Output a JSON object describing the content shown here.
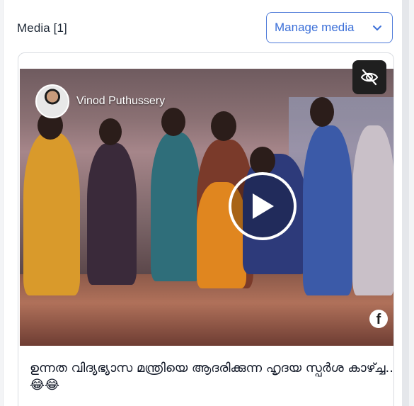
{
  "header": {
    "title": "Media [1]",
    "manage_label": "Manage media"
  },
  "media": {
    "channel_name": "Vinod Puthussery",
    "caption": "ഉന്നത വിദ്യഭ്യാസ മന്ത്രിയെ ആദരിക്കുന്ന ഹൃദയ സ്പർശ കാഴ്ച്ച...😂😂",
    "watermark_icon": "facebook-icon"
  },
  "colors": {
    "accent": "#3b6fd8",
    "border": "#d9dce1",
    "text": "#1f2937"
  }
}
